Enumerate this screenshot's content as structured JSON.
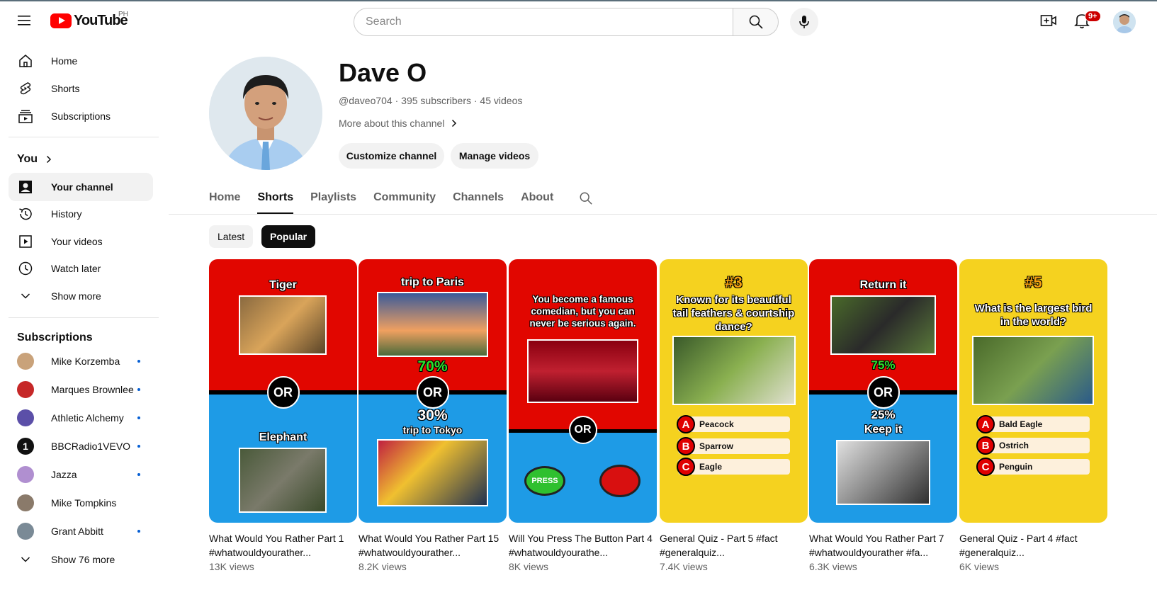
{
  "topbar": {
    "logo_text": "YouTube",
    "country_code": "PH",
    "search_placeholder": "Search",
    "notification_count": "9+"
  },
  "sidebar": {
    "main": [
      {
        "label": "Home",
        "icon": "home-icon"
      },
      {
        "label": "Shorts",
        "icon": "shorts-icon"
      },
      {
        "label": "Subscriptions",
        "icon": "subscriptions-icon"
      }
    ],
    "you_title": "You",
    "you_items": [
      {
        "label": "Your channel",
        "icon": "your-channel-icon"
      },
      {
        "label": "History",
        "icon": "history-icon"
      },
      {
        "label": "Your videos",
        "icon": "your-videos-icon"
      },
      {
        "label": "Watch later",
        "icon": "watch-later-icon"
      },
      {
        "label": "Show more",
        "icon": "chevron-down-icon"
      }
    ],
    "subscriptions_title": "Subscriptions",
    "subscriptions": [
      {
        "label": "Mike Korzemba",
        "color": "#c9a27a",
        "new": true
      },
      {
        "label": "Marques Brownlee",
        "color": "#c62828",
        "new": true
      },
      {
        "label": "Athletic Alchemy",
        "color": "#5b4fa8",
        "new": true
      },
      {
        "label": "BBCRadio1VEVO",
        "color": "#111111",
        "new": true
      },
      {
        "label": "Jazza",
        "color": "#b08fd0",
        "new": true
      },
      {
        "label": "Mike Tompkins",
        "color": "#8a7a6a",
        "new": false
      },
      {
        "label": "Grant Abbitt",
        "color": "#7a8a96",
        "new": true
      }
    ],
    "show_more_subs": "Show 76 more"
  },
  "channel": {
    "name": "Dave O",
    "meta": "@daveo704 · 395 subscribers · 45 videos",
    "more": "More about this channel",
    "customize": "Customize channel",
    "manage": "Manage videos"
  },
  "tabs": [
    "Home",
    "Shorts",
    "Playlists",
    "Community",
    "Channels",
    "About"
  ],
  "chips": [
    "Latest",
    "Popular"
  ],
  "shorts": [
    {
      "title": "What Would You Rather Part 1 #whatwouldyourather...",
      "views": "13K views"
    },
    {
      "title": "What Would You Rather Part 15 #whatwouldyourather...",
      "views": "8.2K views"
    },
    {
      "title": "Will You Press The Button Part 4 #whatwouldyourathe...",
      "views": "8K views"
    },
    {
      "title": "General Quiz - Part 5 #fact #generalquiz...",
      "views": "7.4K views"
    },
    {
      "title": "What Would You Rather Part 7 #whatwouldyourather #fa...",
      "views": "6.3K views"
    },
    {
      "title": "General Quiz - Part 4 #fact #generalquiz...",
      "views": "6K views"
    }
  ],
  "thumbs": {
    "t1": {
      "top": "Tiger",
      "or": "OR",
      "bottom": "Elephant"
    },
    "t2": {
      "top": "trip to Paris",
      "pct_top": "70%",
      "or": "OR",
      "pct_bottom": "30%",
      "bottom": "trip to Tokyo"
    },
    "t3": {
      "text": "You become a famous comedian, but you can never be serious again.",
      "or": "OR",
      "press": "PRESS"
    },
    "t4": {
      "num": "#3",
      "q": "Known for its beautiful tail feathers & courtship dance?",
      "answers": [
        [
          "A",
          "Peacock"
        ],
        [
          "B",
          "Sparrow"
        ],
        [
          "C",
          "Eagle"
        ]
      ]
    },
    "t5": {
      "top": "Return it",
      "pct_top": "75%",
      "or": "OR",
      "pct_bottom": "25%",
      "bottom": "Keep it"
    },
    "t6": {
      "num": "#5",
      "q": "What is the largest bird in the world?",
      "answers": [
        [
          "A",
          "Bald Eagle"
        ],
        [
          "B",
          "Ostrich"
        ],
        [
          "C",
          "Penguin"
        ]
      ]
    }
  },
  "colors": {
    "red": "#e10600",
    "blue": "#1e9be6",
    "yellow": "#f5d21f",
    "brand": "#ff0000"
  }
}
